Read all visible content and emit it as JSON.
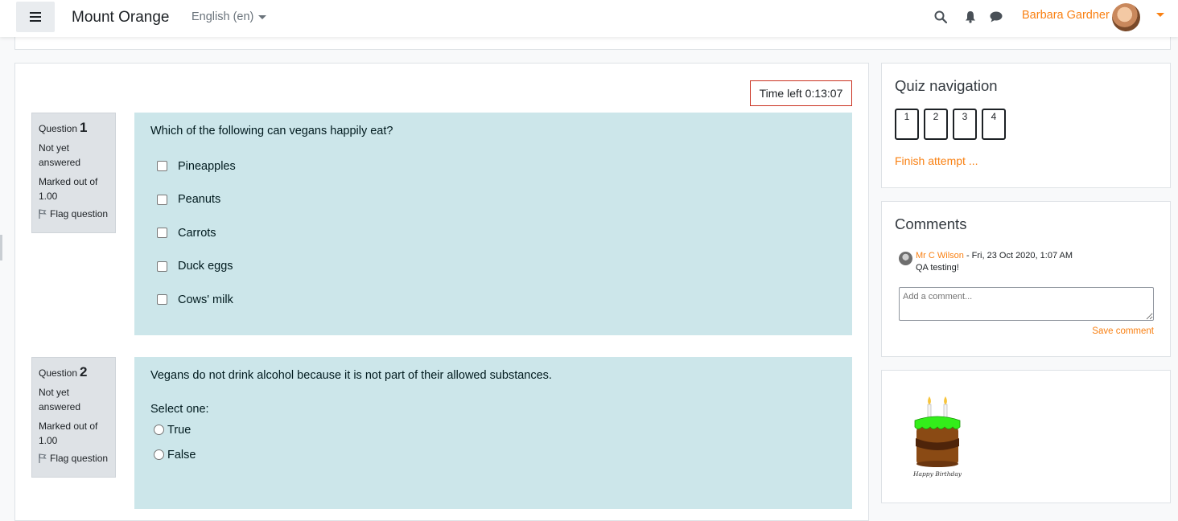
{
  "navbar": {
    "brand": "Mount Orange",
    "language": "English (en)",
    "user_name": "Barbara Gardner"
  },
  "timer": {
    "label": "Time left 0:13:07"
  },
  "questions": [
    {
      "label": "Question",
      "number": "1",
      "status": "Not yet answered",
      "marks": "Marked out of 1.00",
      "flag": "Flag question",
      "text": "Which of the following can vegans happily eat?",
      "options": [
        "Pineapples",
        "Peanuts",
        "Carrots",
        "Duck eggs",
        "Cows' milk"
      ]
    },
    {
      "label": "Question",
      "number": "2",
      "status": "Not yet answered",
      "marks": "Marked out of 1.00",
      "flag": "Flag question",
      "text": "Vegans do not drink alcohol because it is not part of their allowed substances.",
      "prompt": "Select one:",
      "options": [
        "True",
        "False"
      ]
    }
  ],
  "quiz_nav": {
    "title": "Quiz navigation",
    "buttons": [
      "1",
      "2",
      "3",
      "4"
    ],
    "finish": "Finish attempt ..."
  },
  "comments": {
    "title": "Comments",
    "author": "Mr C Wilson",
    "date": " - Fri, 23 Oct 2020, 1:07 AM",
    "text": "QA testing!",
    "placeholder": "Add a comment...",
    "save": "Save comment"
  },
  "birthday": {
    "caption": "Happy Birthday"
  },
  "colors": {
    "accent": "#f98012",
    "question_bg": "#cce6ea",
    "info_bg": "#dee2e6",
    "timer_border": "#ca3120"
  }
}
